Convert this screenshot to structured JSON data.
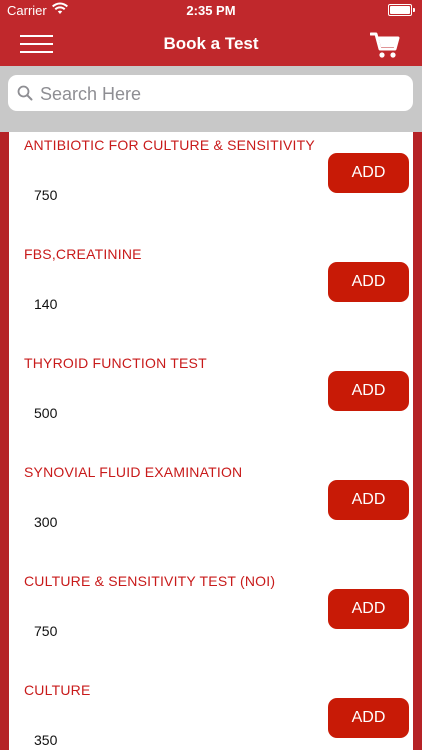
{
  "status_bar": {
    "carrier": "Carrier",
    "time": "2:35 PM"
  },
  "nav": {
    "title": "Book a Test"
  },
  "search": {
    "placeholder": "Search Here"
  },
  "tests": [
    {
      "name": "ANTIBIOTIC FOR CULTURE & SENSITIVITY",
      "price": "750",
      "button": "ADD"
    },
    {
      "name": "FBS,CREATININE",
      "price": "140",
      "button": "ADD"
    },
    {
      "name": "THYROID FUNCTION TEST",
      "price": "500",
      "button": "ADD"
    },
    {
      "name": "SYNOVIAL FLUID EXAMINATION",
      "price": "300",
      "button": "ADD"
    },
    {
      "name": "CULTURE & SENSITIVITY TEST (NOI)",
      "price": "750",
      "button": "ADD"
    },
    {
      "name": "CULTURE",
      "price": "350",
      "button": "ADD"
    }
  ],
  "colors": {
    "primary": "#c0282c",
    "button": "#c81a06",
    "item_title": "#c81a1a"
  },
  "icons": {
    "menu": "hamburger-icon",
    "cart": "cart-icon",
    "search": "search-icon",
    "wifi": "wifi-icon",
    "battery": "battery-icon"
  }
}
